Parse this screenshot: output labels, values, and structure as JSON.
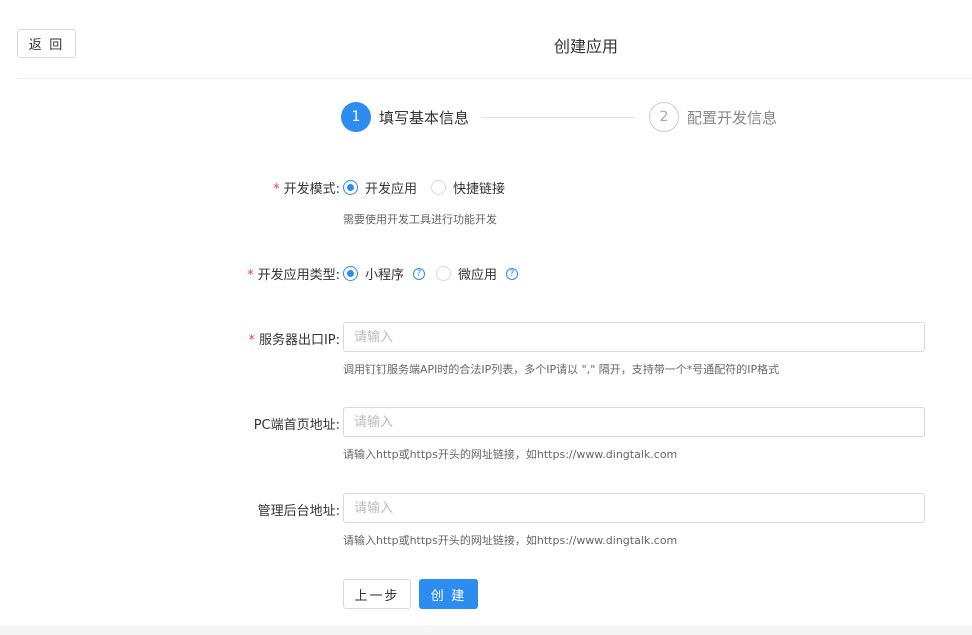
{
  "header": {
    "back_label": "返 回",
    "title": "创建应用"
  },
  "steps": [
    {
      "num": "1",
      "label": "填写基本信息",
      "active": true
    },
    {
      "num": "2",
      "label": "配置开发信息",
      "active": false
    }
  ],
  "form": {
    "dev_mode": {
      "label": "开发模式:",
      "options": [
        "开发应用",
        "快捷链接"
      ],
      "selected": "开发应用",
      "hint": "需要使用开发工具进行功能开发"
    },
    "app_type": {
      "label": "开发应用类型:",
      "options": [
        "小程序",
        "微应用"
      ],
      "selected": "小程序",
      "help_icon": "?"
    },
    "server_ip": {
      "label": "服务器出口IP:",
      "placeholder": "请输入",
      "value": "",
      "hint": "调用钉钉服务端API时的合法IP列表，多个IP请以 \",\" 隔开，支持带一个*号通配符的IP格式"
    },
    "pc_url": {
      "label": "PC端首页地址:",
      "placeholder": "请输入",
      "value": "",
      "hint": "请输入http或https开头的网址链接，如https://www.dingtalk.com"
    },
    "admin_url": {
      "label": "管理后台地址:",
      "placeholder": "请输入",
      "value": "",
      "hint": "请输入http或https开头的网址链接，如https://www.dingtalk.com"
    },
    "required_mark": "*"
  },
  "actions": {
    "prev_label": "上一步",
    "create_label": "创 建"
  },
  "colors": {
    "primary": "#2d8cf0",
    "required": "#e8473f"
  }
}
